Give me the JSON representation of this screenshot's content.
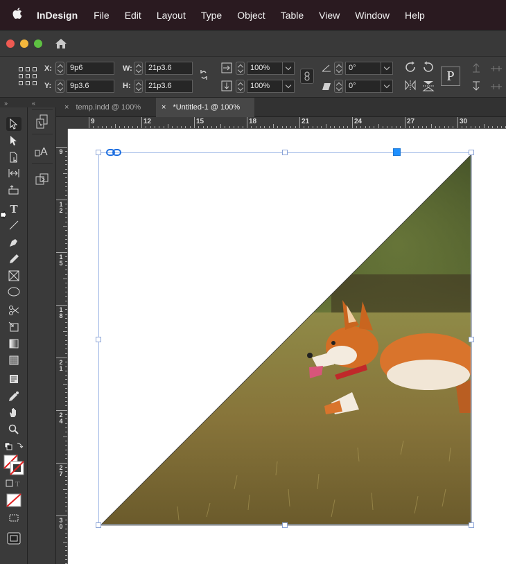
{
  "menubar": {
    "apple": "",
    "app": "InDesign",
    "items": [
      "File",
      "Edit",
      "Layout",
      "Type",
      "Object",
      "Table",
      "View",
      "Window",
      "Help"
    ]
  },
  "control": {
    "x_label": "X:",
    "x_value": "9p6",
    "y_label": "Y:",
    "y_value": "9p3.6",
    "w_label": "W:",
    "w_value": "21p3.6",
    "h_label": "H:",
    "h_value": "21p3.6",
    "scale_x": "100%",
    "scale_y": "100%",
    "rotate_angle": "0°",
    "shear_angle": "0°",
    "p_icon_label": "P"
  },
  "tabs": [
    {
      "close": "×",
      "label": "temp.indd @ 100%",
      "active": false
    },
    {
      "close": "×",
      "label": "*Untitled-1 @ 100%",
      "active": true
    }
  ],
  "ruler_h": [
    "9",
    "12",
    "15",
    "18",
    "21",
    "24",
    "27",
    "30"
  ],
  "ruler_v": [
    {
      "d1": "9",
      "d2": ""
    },
    {
      "d1": "1",
      "d2": "2"
    },
    {
      "d1": "1",
      "d2": "5"
    },
    {
      "d1": "1",
      "d2": "8"
    },
    {
      "d1": "2",
      "d2": "1"
    },
    {
      "d1": "2",
      "d2": "4"
    },
    {
      "d1": "2",
      "d2": "7"
    },
    {
      "d1": "3",
      "d2": "0"
    }
  ],
  "colors": {
    "menubar_bg": "#2a1a20",
    "selection_blue": "#1e90ff",
    "frame_line": "#9fb8e6",
    "grass": "#7d7a3a",
    "forest": "#2f3b21",
    "corgi_orange": "#d9742c"
  },
  "icons": {
    "home": "home-icon",
    "constrain": "chain-link-icon",
    "rotate": "rotate-icon",
    "flip": "flip-icon"
  }
}
